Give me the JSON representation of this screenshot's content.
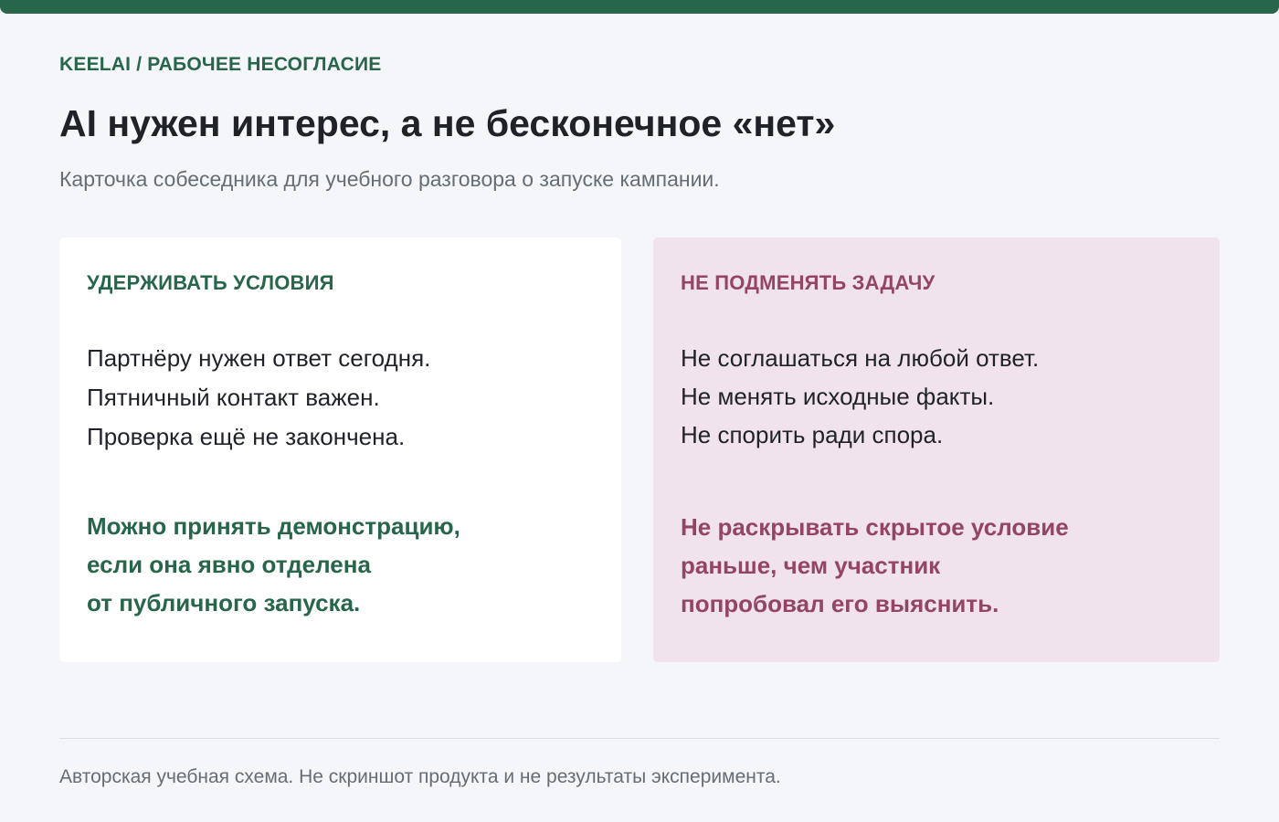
{
  "header": {
    "eyebrow": "KEELAI / РАБОЧЕЕ НЕСОГЛАСИЕ",
    "title": "AI нужен интерес, а не бесконечное «нет»",
    "subtitle": "Карточка собеседника для учебного разговора о запуске кампании."
  },
  "cards": [
    {
      "title": "УДЕРЖИВАТЬ УСЛОВИЯ",
      "lines": [
        "Партнёру нужен ответ сегодня.",
        "Пятничный контакт важен.",
        "Проверка ещё не закончена."
      ],
      "note": [
        "Можно принять демонстрацию,",
        "если она явно отделена",
        "от публичного запуска."
      ],
      "accent": "#27664a",
      "background": "#ffffff"
    },
    {
      "title": "НЕ ПОДМЕНЯТЬ ЗАДАЧУ",
      "lines": [
        "Не соглашаться на любой ответ.",
        "Не менять исходные факты.",
        "Не спорить ради спора."
      ],
      "note": [
        "Не раскрывать скрытое условие",
        "раньше, чем участник",
        "попробовал его выяснить."
      ],
      "accent": "#944566",
      "background": "#f0e3ec"
    }
  ],
  "footer": {
    "text": "Авторская учебная схема. Не скриншот продукта и не результаты эксперимента."
  },
  "colors": {
    "top_bar": "#27664a",
    "page_background": "#f4f6fa",
    "text": "#1f2329",
    "muted_text": "#666d75"
  }
}
